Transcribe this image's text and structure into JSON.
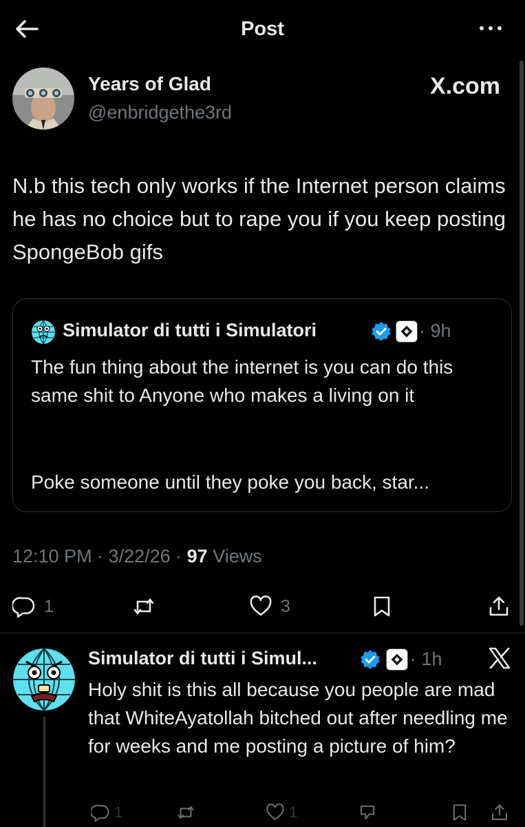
{
  "header": {
    "title": "Post"
  },
  "post": {
    "author_name": "Years of Glad",
    "author_handle": "@enbridgethe3rd",
    "watermark": "X.com",
    "text": "N.b this tech only works if the Internet person claims he has no choice but to rape you if you keep posting SpongeBob gifs",
    "timestamp": "12:10 PM · 3/22/26 · ",
    "views_count": "97",
    "views_label": " Views",
    "stats": {
      "replies": "1",
      "likes": "3"
    }
  },
  "quote": {
    "author_name": "Simulator di tutti i Simulatori",
    "time": "· 9h",
    "text_line1": "The fun thing about the internet is you can do this same shit to Anyone who makes a living on it",
    "text_line2": "Poke someone until they poke you back, star..."
  },
  "reply": {
    "author_name": "Simulator di tutti i Simul...",
    "time": "· 1h",
    "text": "Holy shit is this all because you people are mad that WhiteAyatollah bitched out after needling me for weeks and me posting a picture of him?",
    "stats": {
      "replies": "1",
      "likes": "1"
    }
  },
  "colors": {
    "background": "#000000",
    "text": "#e7e9ea",
    "secondary": "#71767b",
    "verified": "#1d9bf0",
    "border": "#2f3336",
    "avatar_globe": "#5ee0ee"
  },
  "icons": [
    "back-arrow-icon",
    "more-icon",
    "verified-icon",
    "affiliate-badge-icon",
    "reply-icon",
    "repost-icon",
    "like-icon",
    "bookmark-icon",
    "share-icon",
    "x-logo-icon",
    "grok-icon"
  ]
}
